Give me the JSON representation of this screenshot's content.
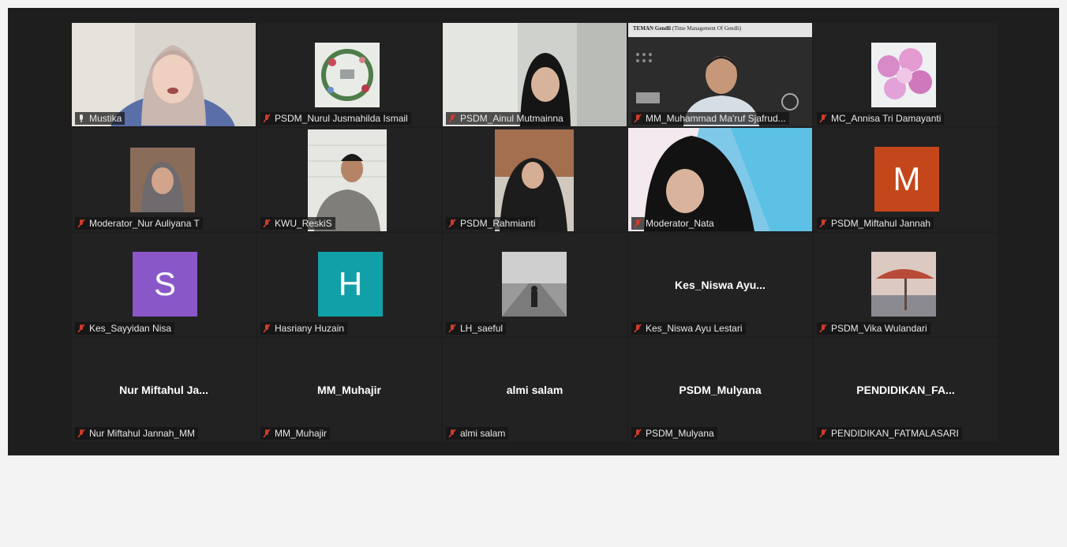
{
  "participants": [
    {
      "name": "Mustika"
    },
    {
      "name": "PSDM_Nurul Jusmahilda Ismail"
    },
    {
      "name": "PSDM_Ainul Mutmainna"
    },
    {
      "name": "MM_Muhammad Ma'ruf Sjafrud..."
    },
    {
      "name": "MC_Annisa Tri Damayanti"
    },
    {
      "name": "Moderator_Nur Auliyana T"
    },
    {
      "name": "KWU_ReskiS"
    },
    {
      "name": "PSDM_Rahmianti"
    },
    {
      "name": "Moderator_Nata"
    },
    {
      "name": "PSDM_Miftahul Jannah",
      "avatar_letter": "M",
      "avatar_color": "#c4471b"
    },
    {
      "name": "Kes_Sayyidan Nisa",
      "avatar_letter": "S",
      "avatar_color": "#8a57c9"
    },
    {
      "name": "Hasriany Huzain",
      "avatar_letter": "H",
      "avatar_color": "#12a0a8"
    },
    {
      "name": "LH_saeful"
    },
    {
      "name": "Kes_Niswa Ayu Lestari",
      "display_text": "Kes_Niswa Ayu..."
    },
    {
      "name": "PSDM_Vika Wulandari"
    },
    {
      "name": "Nur Miftahul Jannah_MM",
      "display_text": "Nur Miftahul Ja..."
    },
    {
      "name": "MM_Muhajir",
      "display_text": "MM_Muhajir"
    },
    {
      "name": "almi salam",
      "display_text": "almi salam"
    },
    {
      "name": "PSDM_Mulyana",
      "display_text": "PSDM_Mulyana"
    },
    {
      "name": "PENDIDIKAN_FATMALASARI",
      "display_text": "PENDIDIKAN_FA..."
    }
  ],
  "slide": {
    "title": "TEMAN Gendli",
    "subtitle": "(Time Management Of Gendli)"
  },
  "colors": {
    "active_border": "#c7d64a",
    "muted_mic": "#d23b2a",
    "tile_bg": "#222222"
  }
}
